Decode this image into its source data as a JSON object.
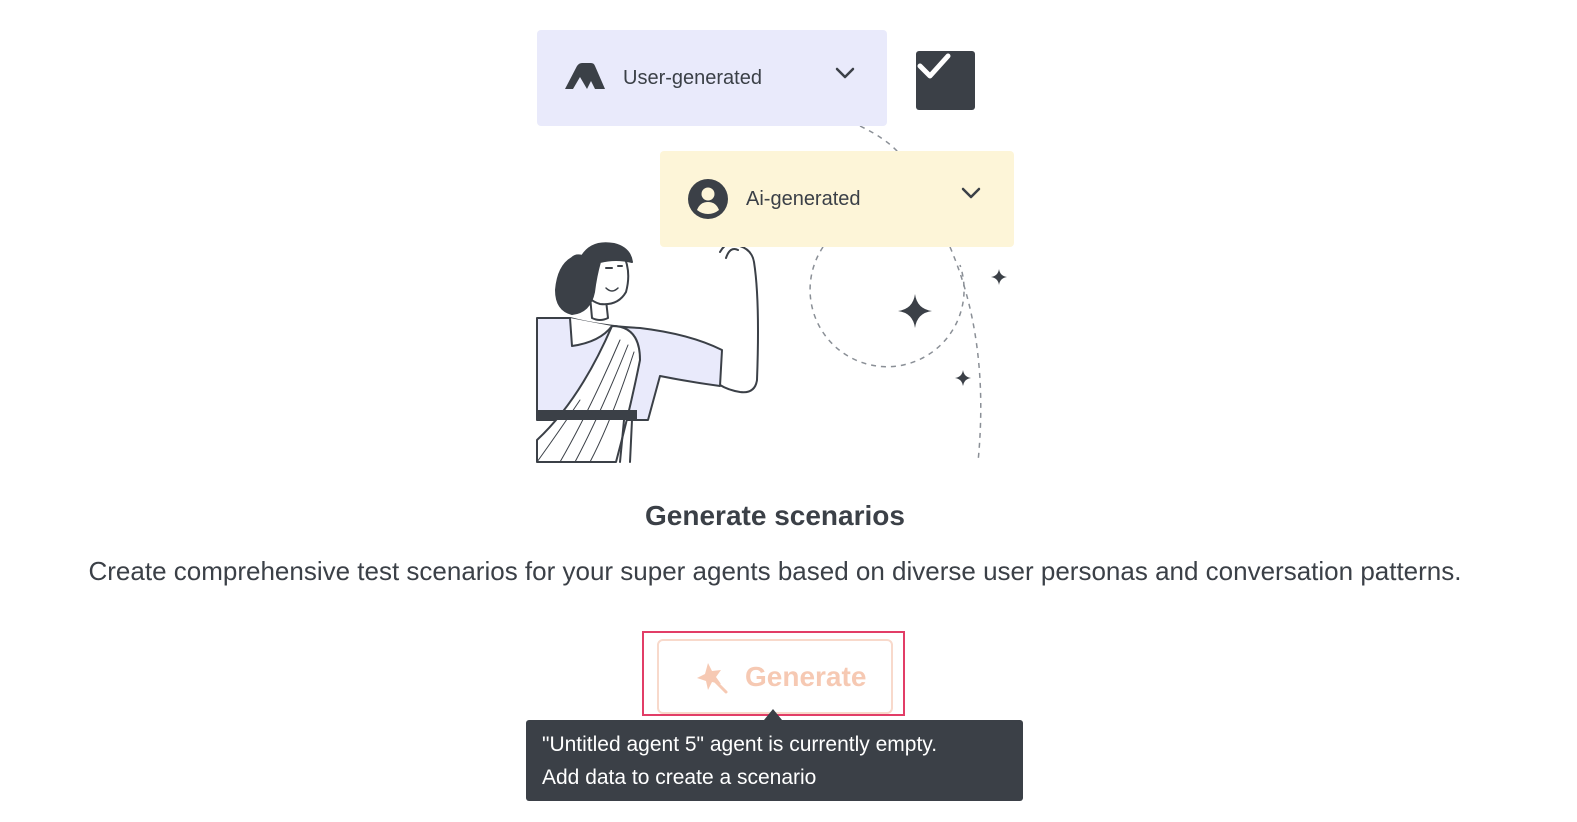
{
  "illustration": {
    "user_card": {
      "label": "User-generated",
      "icon": "mountains-logo-icon",
      "background": "#e9eafb"
    },
    "ai_card": {
      "label": "Ai-generated",
      "icon": "user-circle-icon",
      "background": "#fdf5d8"
    },
    "checkbox": {
      "checked": true,
      "color": "#3b4047"
    }
  },
  "empty_state": {
    "title": "Generate scenarios",
    "description": "Create comprehensive test scenarios for your super agents based on diverse user personas and conversation patterns."
  },
  "generate_button": {
    "label": "Generate",
    "icon": "magic-wand-icon",
    "state": "disabled",
    "text_color": "#f6c9b3",
    "focus_color": "#e23d67"
  },
  "tooltip": {
    "line1": "\"Untitled agent 5\" agent is currently empty.",
    "line2": "Add data to create a scenario"
  }
}
